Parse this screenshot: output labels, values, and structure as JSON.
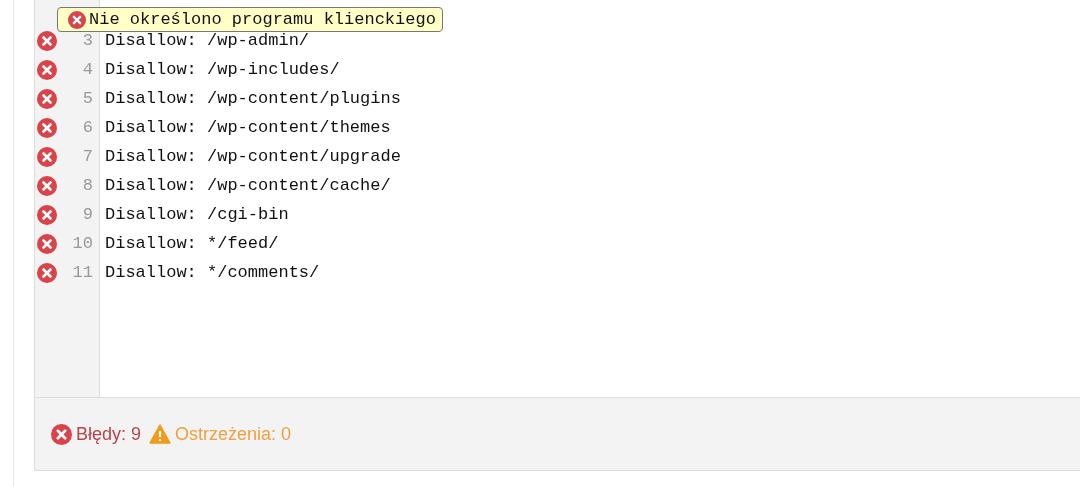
{
  "tooltip": {
    "message": "Nie określono programu klienckiego"
  },
  "lines": [
    {
      "number": "3",
      "text": "Disallow: /wp-admin/",
      "error": true
    },
    {
      "number": "4",
      "text": "Disallow: /wp-includes/",
      "error": true
    },
    {
      "number": "5",
      "text": "Disallow: /wp-content/plugins",
      "error": true
    },
    {
      "number": "6",
      "text": "Disallow: /wp-content/themes",
      "error": true
    },
    {
      "number": "7",
      "text": "Disallow: /wp-content/upgrade",
      "error": true
    },
    {
      "number": "8",
      "text": "Disallow: /wp-content/cache/",
      "error": true
    },
    {
      "number": "9",
      "text": "Disallow: /cgi-bin",
      "error": true
    },
    {
      "number": "10",
      "text": "Disallow: */feed/",
      "error": true
    },
    {
      "number": "11",
      "text": "Disallow: */comments/",
      "error": true
    }
  ],
  "status_bar": {
    "errors": "Błędy: 9",
    "warnings": "Ostrzeżenia: 0"
  }
}
